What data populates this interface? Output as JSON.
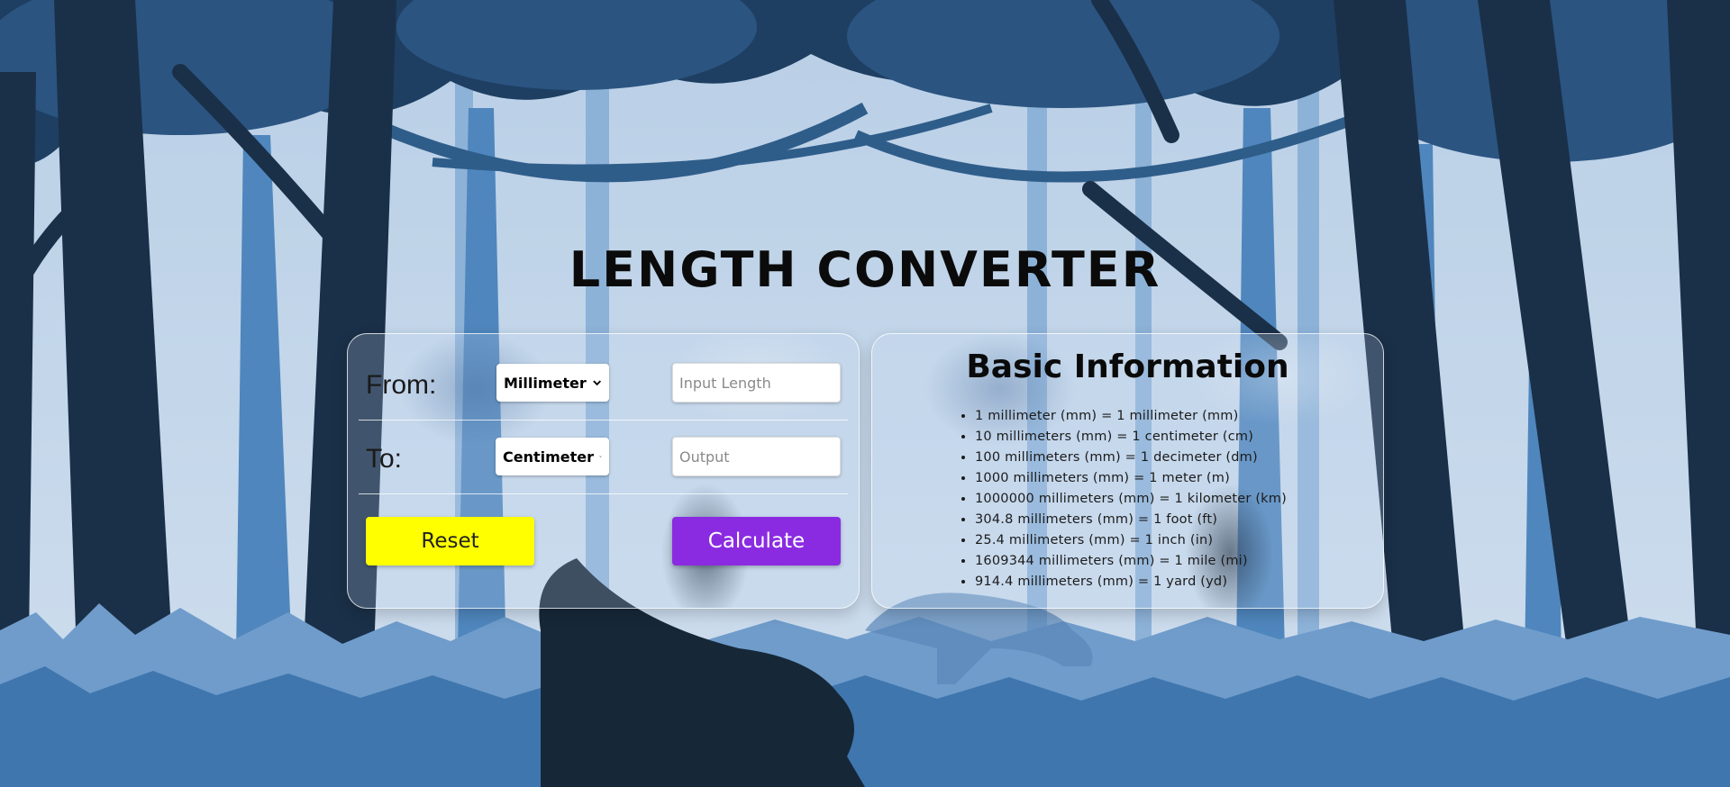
{
  "page": {
    "title": "LENGTH CONVERTER"
  },
  "converter": {
    "from_label": "From:",
    "from_unit": "Millimeter",
    "input_placeholder": "Input Length",
    "to_label": "To:",
    "to_unit": "Centimeter",
    "output_placeholder": "Output",
    "reset_label": "Reset",
    "calculate_label": "Calculate",
    "reset_color": "#ffff00",
    "calculate_color": "#8a2be2"
  },
  "info": {
    "title": "Basic Information",
    "items": [
      "1 millimeter (mm) = 1 millimeter (mm)",
      "10 millimeters (mm) = 1 centimeter (cm)",
      "100 millimeters (mm) = 1 decimeter (dm)",
      "1000 millimeters (mm) = 1 meter (m)",
      "1000000 millimeters (mm) = 1 kilometer (km)",
      "304.8 millimeters (mm) = 1 foot (ft)",
      "25.4 millimeters (mm) = 1 inch (in)",
      "1609344 millimeters (mm) = 1 mile (mi)",
      "914.4 millimeters (mm) = 1 yard (yd)"
    ]
  },
  "background": {
    "scene": "forest-silhouette",
    "colors": [
      "#c3d6ea",
      "#7ea7cf",
      "#4a7fb5",
      "#2e5a88",
      "#1c3a5a",
      "#162838"
    ]
  },
  "icons": {
    "select_arrow": "chevron-down-icon"
  }
}
